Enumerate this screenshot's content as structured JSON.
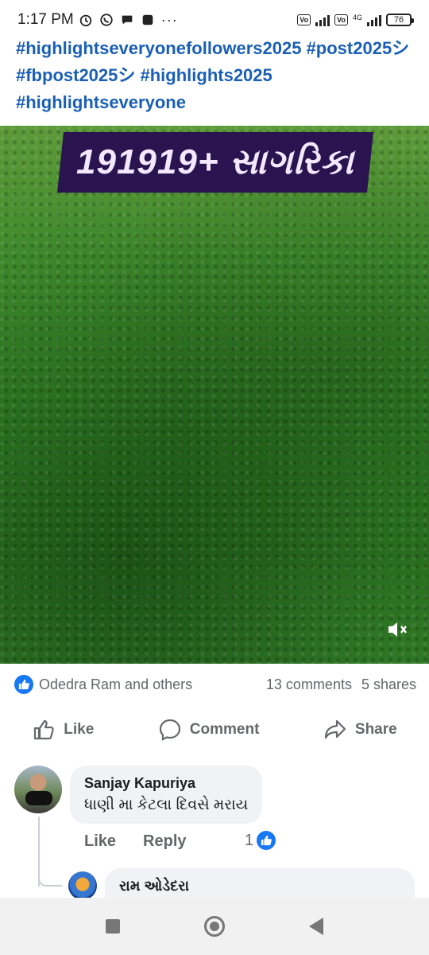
{
  "status_bar": {
    "time": "1:17 PM",
    "battery": "76",
    "network_label": "4G",
    "icons": [
      "alarm-icon",
      "whatsapp-icon",
      "chat-icon",
      "notification-icon",
      "more-icon"
    ]
  },
  "post": {
    "caption": "#highlightseveryonefollowers2025 #post2025シ #fbpost2025シ #highlights2025 #highlightseveryone",
    "media": {
      "banner_text": "191919+ સાગરિકા",
      "banner_color": "#2a1450",
      "mute_icon": "volume-muted-icon"
    },
    "reactions": {
      "summary": "Odedra Ram and others",
      "comments": "13 comments",
      "shares": "5 shares"
    },
    "actions": {
      "like": "Like",
      "comment": "Comment",
      "share": "Share"
    }
  },
  "comments": [
    {
      "author": "Sanjay Kapuriya",
      "text": "ધાણી મા કેટલા દિવસે મરાય",
      "like_label": "Like",
      "reply_label": "Reply",
      "reaction_count": "1",
      "reply": {
        "author": "રામ ઓડેદરા"
      }
    }
  ],
  "colors": {
    "accent": "#1877f2",
    "caption_link": "#1a5fb4"
  }
}
